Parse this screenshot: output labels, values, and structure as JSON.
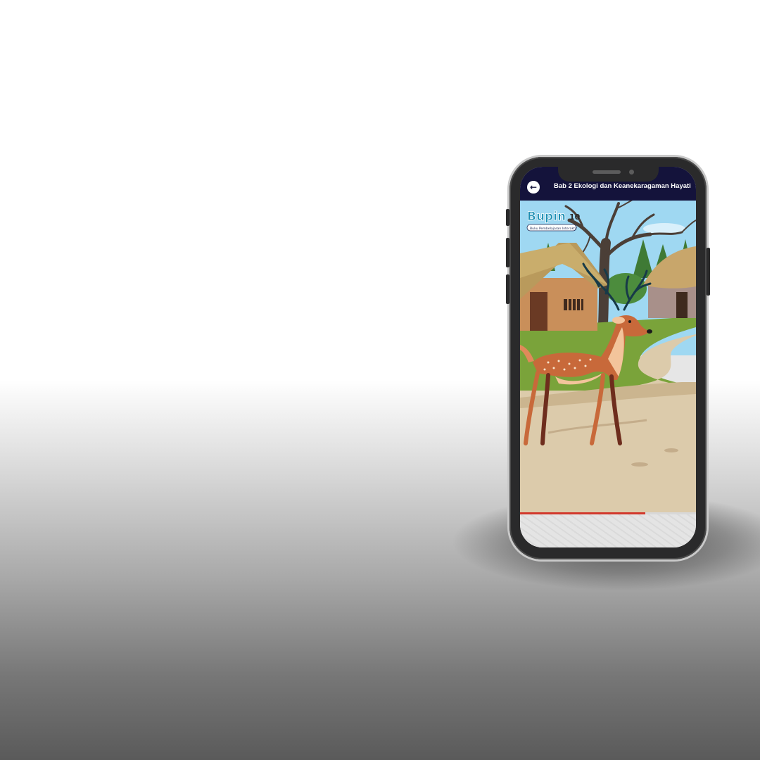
{
  "app_bar": {
    "back_icon": "arrow-left-icon",
    "title": "Bab 2 Ekologi dan Keanekaragaman Hayati"
  },
  "logo": {
    "brand": "Bupin",
    "grade": "10",
    "tagline": "Buku Pembelajaran Interaktif"
  },
  "video": {
    "progress_fraction": 0.71
  },
  "colors": {
    "app_bar": "#14133b",
    "progress": "#d1382b",
    "sky": "#9fd8f2",
    "grass": "#7aa33a",
    "path": "#dccbab",
    "deer": "#c8693a"
  }
}
